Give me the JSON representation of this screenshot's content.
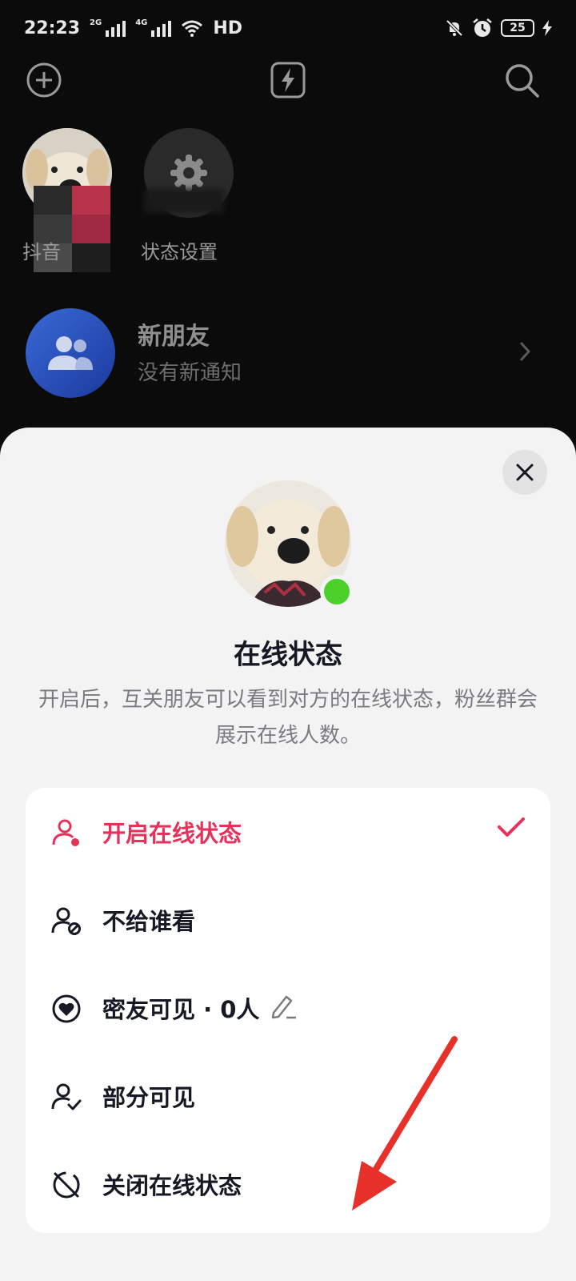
{
  "status_bar": {
    "time": "22:23",
    "network_1": "2G",
    "network_2": "4G",
    "hd_label": "HD",
    "battery": "25"
  },
  "top_bar": {
    "add_icon": "plus-circle-icon",
    "flash_icon": "lightning-icon",
    "search_icon": "search-icon"
  },
  "stories": {
    "my_label": "抖音",
    "settings_label": "状态设置"
  },
  "new_friends": {
    "title": "新朋友",
    "subtitle": "没有新通知"
  },
  "sheet": {
    "title": "在线状态",
    "description": "开启后，互关朋友可以看到对方的在线状态，粉丝群会展示在线人数。",
    "options": [
      {
        "label": "开启在线状态",
        "icon": "user-online-icon",
        "selected": true
      },
      {
        "label": "不给谁看",
        "icon": "user-block-icon",
        "selected": false
      },
      {
        "label": "密友可见 · 0人",
        "icon": "heart-circle-icon",
        "selected": false
      },
      {
        "label": "部分可见",
        "icon": "user-check-icon",
        "selected": false
      },
      {
        "label": "关闭在线状态",
        "icon": "offline-icon",
        "selected": false
      }
    ]
  },
  "colors": {
    "accent": "#e5325a",
    "online": "#4bd12a",
    "sheet_bg": "#f3f3f3",
    "annotation_arrow": "#e8302a"
  }
}
